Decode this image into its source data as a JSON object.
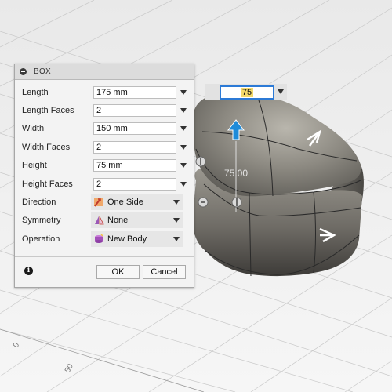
{
  "dialog": {
    "title": "BOX",
    "rows": [
      {
        "label": "Length",
        "value": "175 mm"
      },
      {
        "label": "Length Faces",
        "value": "2"
      },
      {
        "label": "Width",
        "value": "150 mm"
      },
      {
        "label": "Width Faces",
        "value": "2"
      },
      {
        "label": "Height",
        "value": "75 mm"
      },
      {
        "label": "Height Faces",
        "value": "2"
      }
    ],
    "selects": [
      {
        "label": "Direction",
        "value": "One Side",
        "icon": "one-side-direction-icon"
      },
      {
        "label": "Symmetry",
        "value": "None",
        "icon": "symmetry-icon"
      },
      {
        "label": "Operation",
        "value": "New Body",
        "icon": "new-body-icon"
      }
    ],
    "ok_label": "OK",
    "cancel_label": "Cancel"
  },
  "viewport": {
    "height_input_value": "75",
    "dimension_label": "75.00",
    "ruler_labels": [
      "0",
      "50"
    ]
  },
  "colors": {
    "accent": "#2c7ad6",
    "input_highlight": "#f3d96a",
    "manipulator_arrow": "#1f8bd9"
  }
}
